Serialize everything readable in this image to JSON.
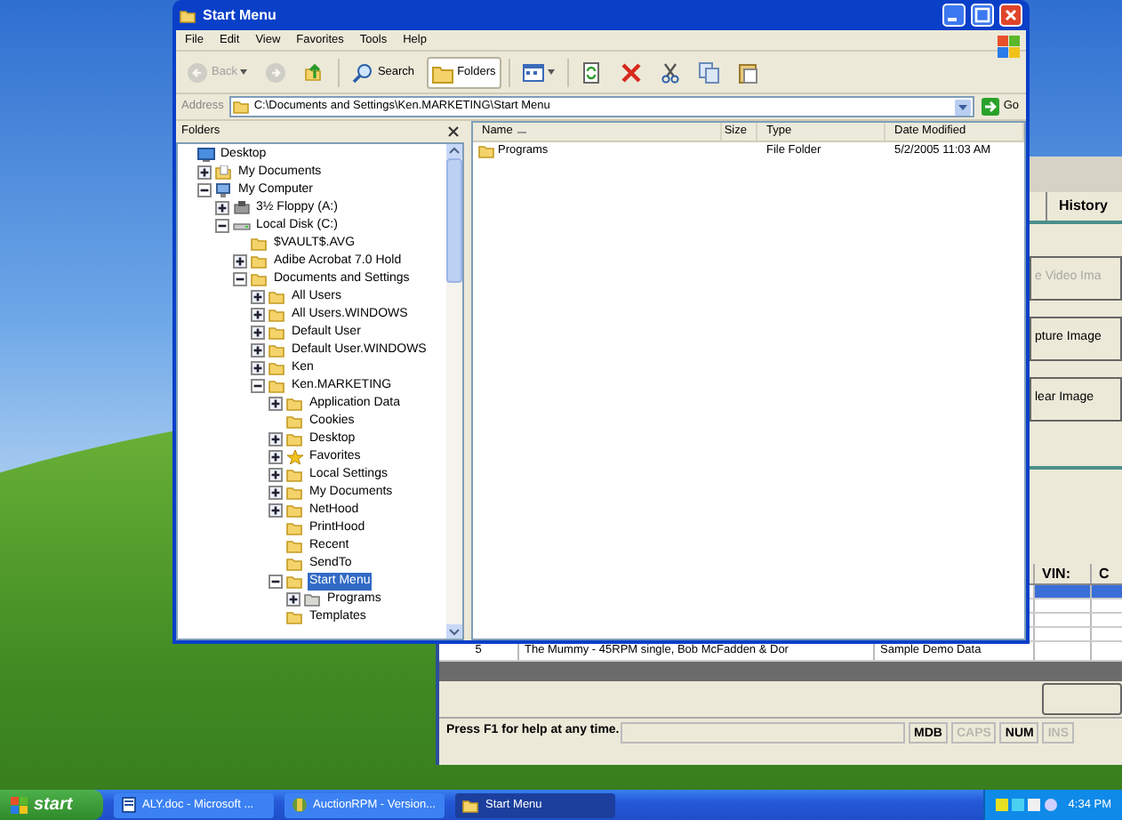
{
  "explorer": {
    "title": "Start Menu",
    "menu": [
      "File",
      "Edit",
      "View",
      "Favorites",
      "Tools",
      "Help"
    ],
    "toolbar": [
      {
        "kind": "back",
        "label": "Back",
        "disabled": true,
        "pressed": false
      },
      {
        "kind": "forward",
        "disabled": true,
        "pressed": false
      },
      {
        "kind": "up",
        "disabled": false,
        "pressed": false
      },
      {
        "kind": "search",
        "label": "Search",
        "disabled": false,
        "pressed": false
      },
      {
        "kind": "folders",
        "label": "Folders",
        "disabled": false,
        "pressed": true
      },
      {
        "kind": "views",
        "disabled": false,
        "pressed": false
      },
      {
        "kind": "sync",
        "disabled": false,
        "pressed": false
      },
      {
        "kind": "delete",
        "disabled": false,
        "pressed": false
      },
      {
        "kind": "cut",
        "disabled": false,
        "pressed": false
      },
      {
        "kind": "copy",
        "disabled": false,
        "pressed": false
      },
      {
        "kind": "paste",
        "disabled": false,
        "pressed": false
      }
    ],
    "address": {
      "label": "Address",
      "value": "C:\\Documents and Settings\\Ken.MARKETING\\Start Menu",
      "go": "Go"
    },
    "folders_pane": {
      "title": "Folders",
      "tree": [
        {
          "label": "Desktop",
          "kind": "desktop",
          "toggle": false,
          "selected": false,
          "children": [
            {
              "label": "My Documents",
              "kind": "documents",
              "toggle": true,
              "expanded": false,
              "selected": false
            },
            {
              "label": "My Computer",
              "kind": "computer",
              "toggle": true,
              "expanded": true,
              "selected": false,
              "children": [
                {
                  "label": "3½ Floppy (A:)",
                  "kind": "floppy",
                  "toggle": true,
                  "expanded": false,
                  "selected": false
                },
                {
                  "label": "Local Disk (C:)",
                  "kind": "drive",
                  "toggle": true,
                  "expanded": true,
                  "selected": false,
                  "children": [
                    {
                      "label": "$VAULT$.AVG",
                      "kind": "folder",
                      "toggle": false,
                      "selected": false
                    },
                    {
                      "label": "Adibe Acrobat 7.0 Hold",
                      "kind": "folder",
                      "toggle": true,
                      "expanded": false,
                      "selected": false
                    },
                    {
                      "label": "Documents and Settings",
                      "kind": "folder",
                      "toggle": true,
                      "expanded": true,
                      "selected": false,
                      "children": [
                        {
                          "label": "All Users",
                          "kind": "folder",
                          "toggle": true,
                          "expanded": false,
                          "selected": false
                        },
                        {
                          "label": "All Users.WINDOWS",
                          "kind": "folder",
                          "toggle": true,
                          "expanded": false,
                          "selected": false
                        },
                        {
                          "label": "Default User",
                          "kind": "folder",
                          "toggle": true,
                          "expanded": false,
                          "selected": false
                        },
                        {
                          "label": "Default User.WINDOWS",
                          "kind": "folder",
                          "toggle": true,
                          "expanded": false,
                          "selected": false
                        },
                        {
                          "label": "Ken",
                          "kind": "folder",
                          "toggle": true,
                          "expanded": false,
                          "selected": false
                        },
                        {
                          "label": "Ken.MARKETING",
                          "kind": "folder",
                          "toggle": true,
                          "expanded": true,
                          "selected": false,
                          "children": [
                            {
                              "label": "Application Data",
                              "kind": "folder",
                              "toggle": true,
                              "expanded": false,
                              "selected": false
                            },
                            {
                              "label": "Cookies",
                              "kind": "folder",
                              "toggle": false,
                              "selected": false
                            },
                            {
                              "label": "Desktop",
                              "kind": "folder",
                              "toggle": true,
                              "expanded": false,
                              "selected": false
                            },
                            {
                              "label": "Favorites",
                              "kind": "star",
                              "toggle": true,
                              "expanded": false,
                              "selected": false
                            },
                            {
                              "label": "Local Settings",
                              "kind": "folder",
                              "toggle": true,
                              "expanded": false,
                              "selected": false
                            },
                            {
                              "label": "My Documents",
                              "kind": "folder",
                              "toggle": true,
                              "expanded": false,
                              "selected": false
                            },
                            {
                              "label": "NetHood",
                              "kind": "folder",
                              "toggle": true,
                              "expanded": false,
                              "selected": false
                            },
                            {
                              "label": "PrintHood",
                              "kind": "folder",
                              "toggle": false,
                              "selected": false
                            },
                            {
                              "label": "Recent",
                              "kind": "folder",
                              "toggle": false,
                              "selected": false
                            },
                            {
                              "label": "SendTo",
                              "kind": "folder",
                              "toggle": false,
                              "selected": false
                            },
                            {
                              "label": "Start Menu",
                              "kind": "folder",
                              "toggle": true,
                              "expanded": true,
                              "selected": true,
                              "children": [
                                {
                                  "label": "Programs",
                                  "kind": "programs",
                                  "toggle": true,
                                  "expanded": false,
                                  "selected": false
                                }
                              ]
                            },
                            {
                              "label": "Templates",
                              "kind": "folder",
                              "toggle": false,
                              "selected": false
                            }
                          ]
                        }
                      ]
                    }
                  ]
                }
              ]
            }
          ]
        }
      ]
    },
    "list": {
      "columns": [
        {
          "label": "Name",
          "sorted": true
        },
        {
          "label": "Size",
          "sorted": false
        },
        {
          "label": "Type",
          "sorted": false
        },
        {
          "label": "Date Modified",
          "sorted": false
        }
      ],
      "rows": [
        {
          "name": "Programs",
          "type": "File Folder",
          "date": "5/2/2005 11:03 AM"
        }
      ]
    }
  },
  "auction_app": {
    "tabs": [
      {
        "label": "History",
        "selected": false
      }
    ],
    "buttons": [
      {
        "label": "e Video Ima",
        "disabled": true
      },
      {
        "label": "pture Image",
        "disabled": false
      },
      {
        "label": "lear Image",
        "disabled": false
      }
    ],
    "grid": {
      "columns": [
        "VIN:",
        "C"
      ],
      "rows": [
        {
          "selected": true
        },
        {
          "selected": false
        },
        {
          "selected": false
        },
        {
          "selected": false
        },
        {
          "selected": false,
          "cells": [
            "5",
            "The Mummy - 45RPM single, Bob McFadden & Dor",
            "Sample Demo Data"
          ]
        }
      ]
    },
    "status_bar": {
      "message": "Press F1 for help at any time.",
      "indicators": [
        {
          "label": "MDB",
          "on": true
        },
        {
          "label": "CAPS",
          "on": false
        },
        {
          "label": "NUM",
          "on": true
        },
        {
          "label": "INS",
          "on": false
        }
      ]
    }
  },
  "taskbar": {
    "start": "start",
    "tasks": [
      {
        "label": "ALY.doc - Microsoft ...",
        "kind": "word",
        "selected": false
      },
      {
        "label": "AuctionRPM - Version...",
        "kind": "app",
        "selected": false
      },
      {
        "label": "Start Menu",
        "kind": "folder",
        "selected": true
      }
    ],
    "clock": "4:34 PM"
  }
}
